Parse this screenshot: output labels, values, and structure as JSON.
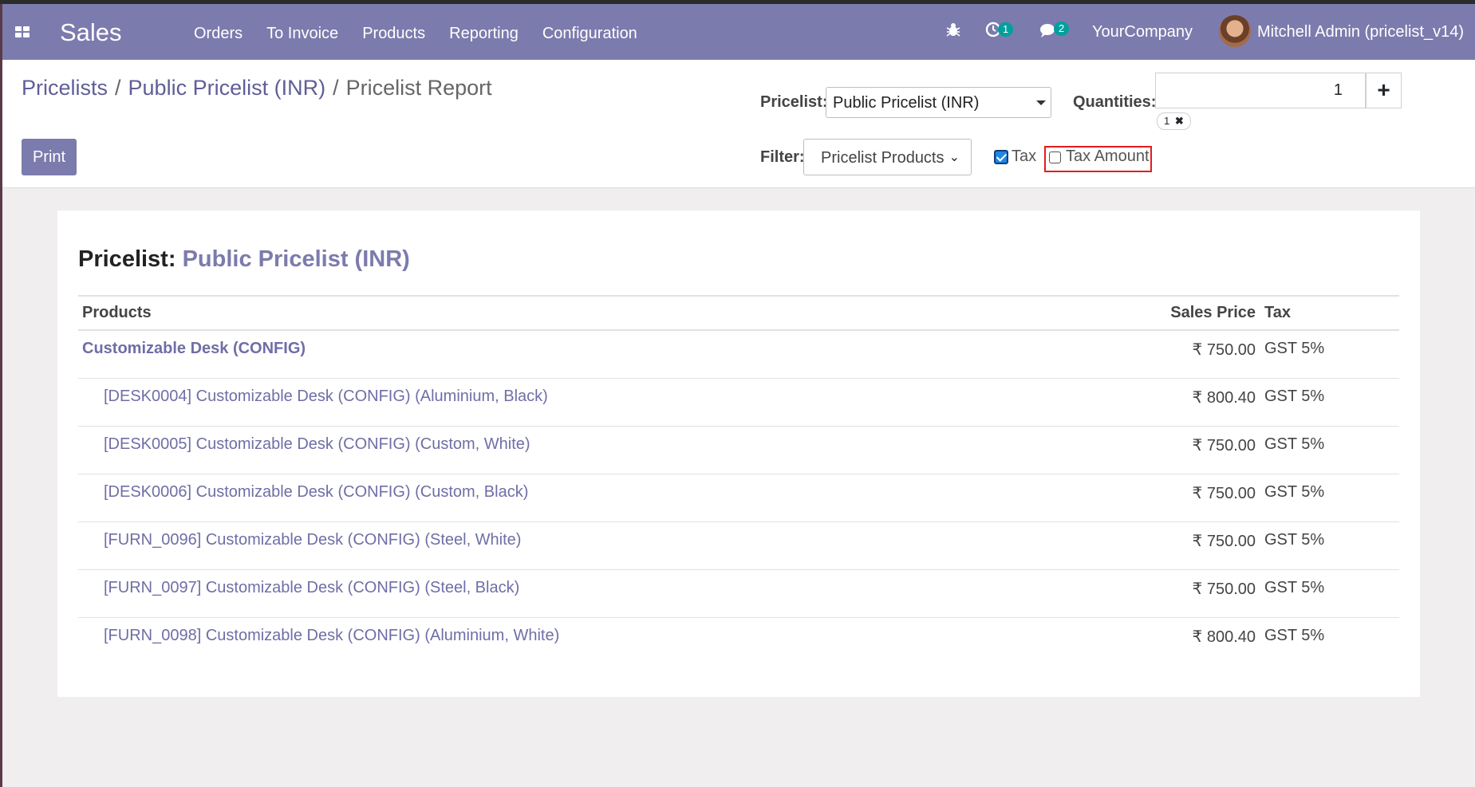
{
  "navbar": {
    "app_name": "Sales",
    "menu": [
      "Orders",
      "To Invoice",
      "Products",
      "Reporting",
      "Configuration"
    ],
    "activity_count": "1",
    "message_count": "2",
    "company": "YourCompany",
    "user": "Mitchell Admin (pricelist_v14)",
    "icons": [
      "apps-icon",
      "bug-icon",
      "clock-icon",
      "chat-icon"
    ]
  },
  "breadcrumb": {
    "items": [
      "Pricelists",
      "Public Pricelist (INR)"
    ],
    "current": "Pricelist Report",
    "separator": "/"
  },
  "controls": {
    "print_label": "Print",
    "pricelist_label": "Pricelist:",
    "pricelist_value": "Public Pricelist (INR)",
    "quantities_label": "Quantities:",
    "quantity_value": "1",
    "add_label": "+",
    "quantity_tags": [
      "1"
    ],
    "filter_label": "Filter:",
    "filter_value": "Pricelist Products",
    "tax_label": "Tax",
    "tax_checked": true,
    "tax_amount_label": "Tax Amount",
    "tax_amount_checked": false
  },
  "report": {
    "title_label": "Pricelist:",
    "title_value": "Public Pricelist (INR)",
    "columns": [
      "Products",
      "Sales Price",
      "Tax"
    ],
    "rows": [
      {
        "name": "Customizable Desk (CONFIG)",
        "price": "₹ 750.00",
        "tax": "GST 5%",
        "parent": true
      },
      {
        "name": "[DESK0004] Customizable Desk (CONFIG) (Aluminium, Black)",
        "price": "₹ 800.40",
        "tax": "GST 5%",
        "parent": false
      },
      {
        "name": "[DESK0005] Customizable Desk (CONFIG) (Custom, White)",
        "price": "₹ 750.00",
        "tax": "GST 5%",
        "parent": false
      },
      {
        "name": "[DESK0006] Customizable Desk (CONFIG) (Custom, Black)",
        "price": "₹ 750.00",
        "tax": "GST 5%",
        "parent": false
      },
      {
        "name": "[FURN_0096] Customizable Desk (CONFIG) (Steel, White)",
        "price": "₹ 750.00",
        "tax": "GST 5%",
        "parent": false
      },
      {
        "name": "[FURN_0097] Customizable Desk (CONFIG) (Steel, Black)",
        "price": "₹ 750.00",
        "tax": "GST 5%",
        "parent": false
      },
      {
        "name": "[FURN_0098] Customizable Desk (CONFIG) (Aluminium, White)",
        "price": "₹ 800.40",
        "tax": "GST 5%",
        "parent": false
      }
    ]
  },
  "colors": {
    "navbar": "#7c7bad",
    "accent": "#7c7bad",
    "badge": "#00a09d",
    "highlight": "#e31c1c"
  }
}
